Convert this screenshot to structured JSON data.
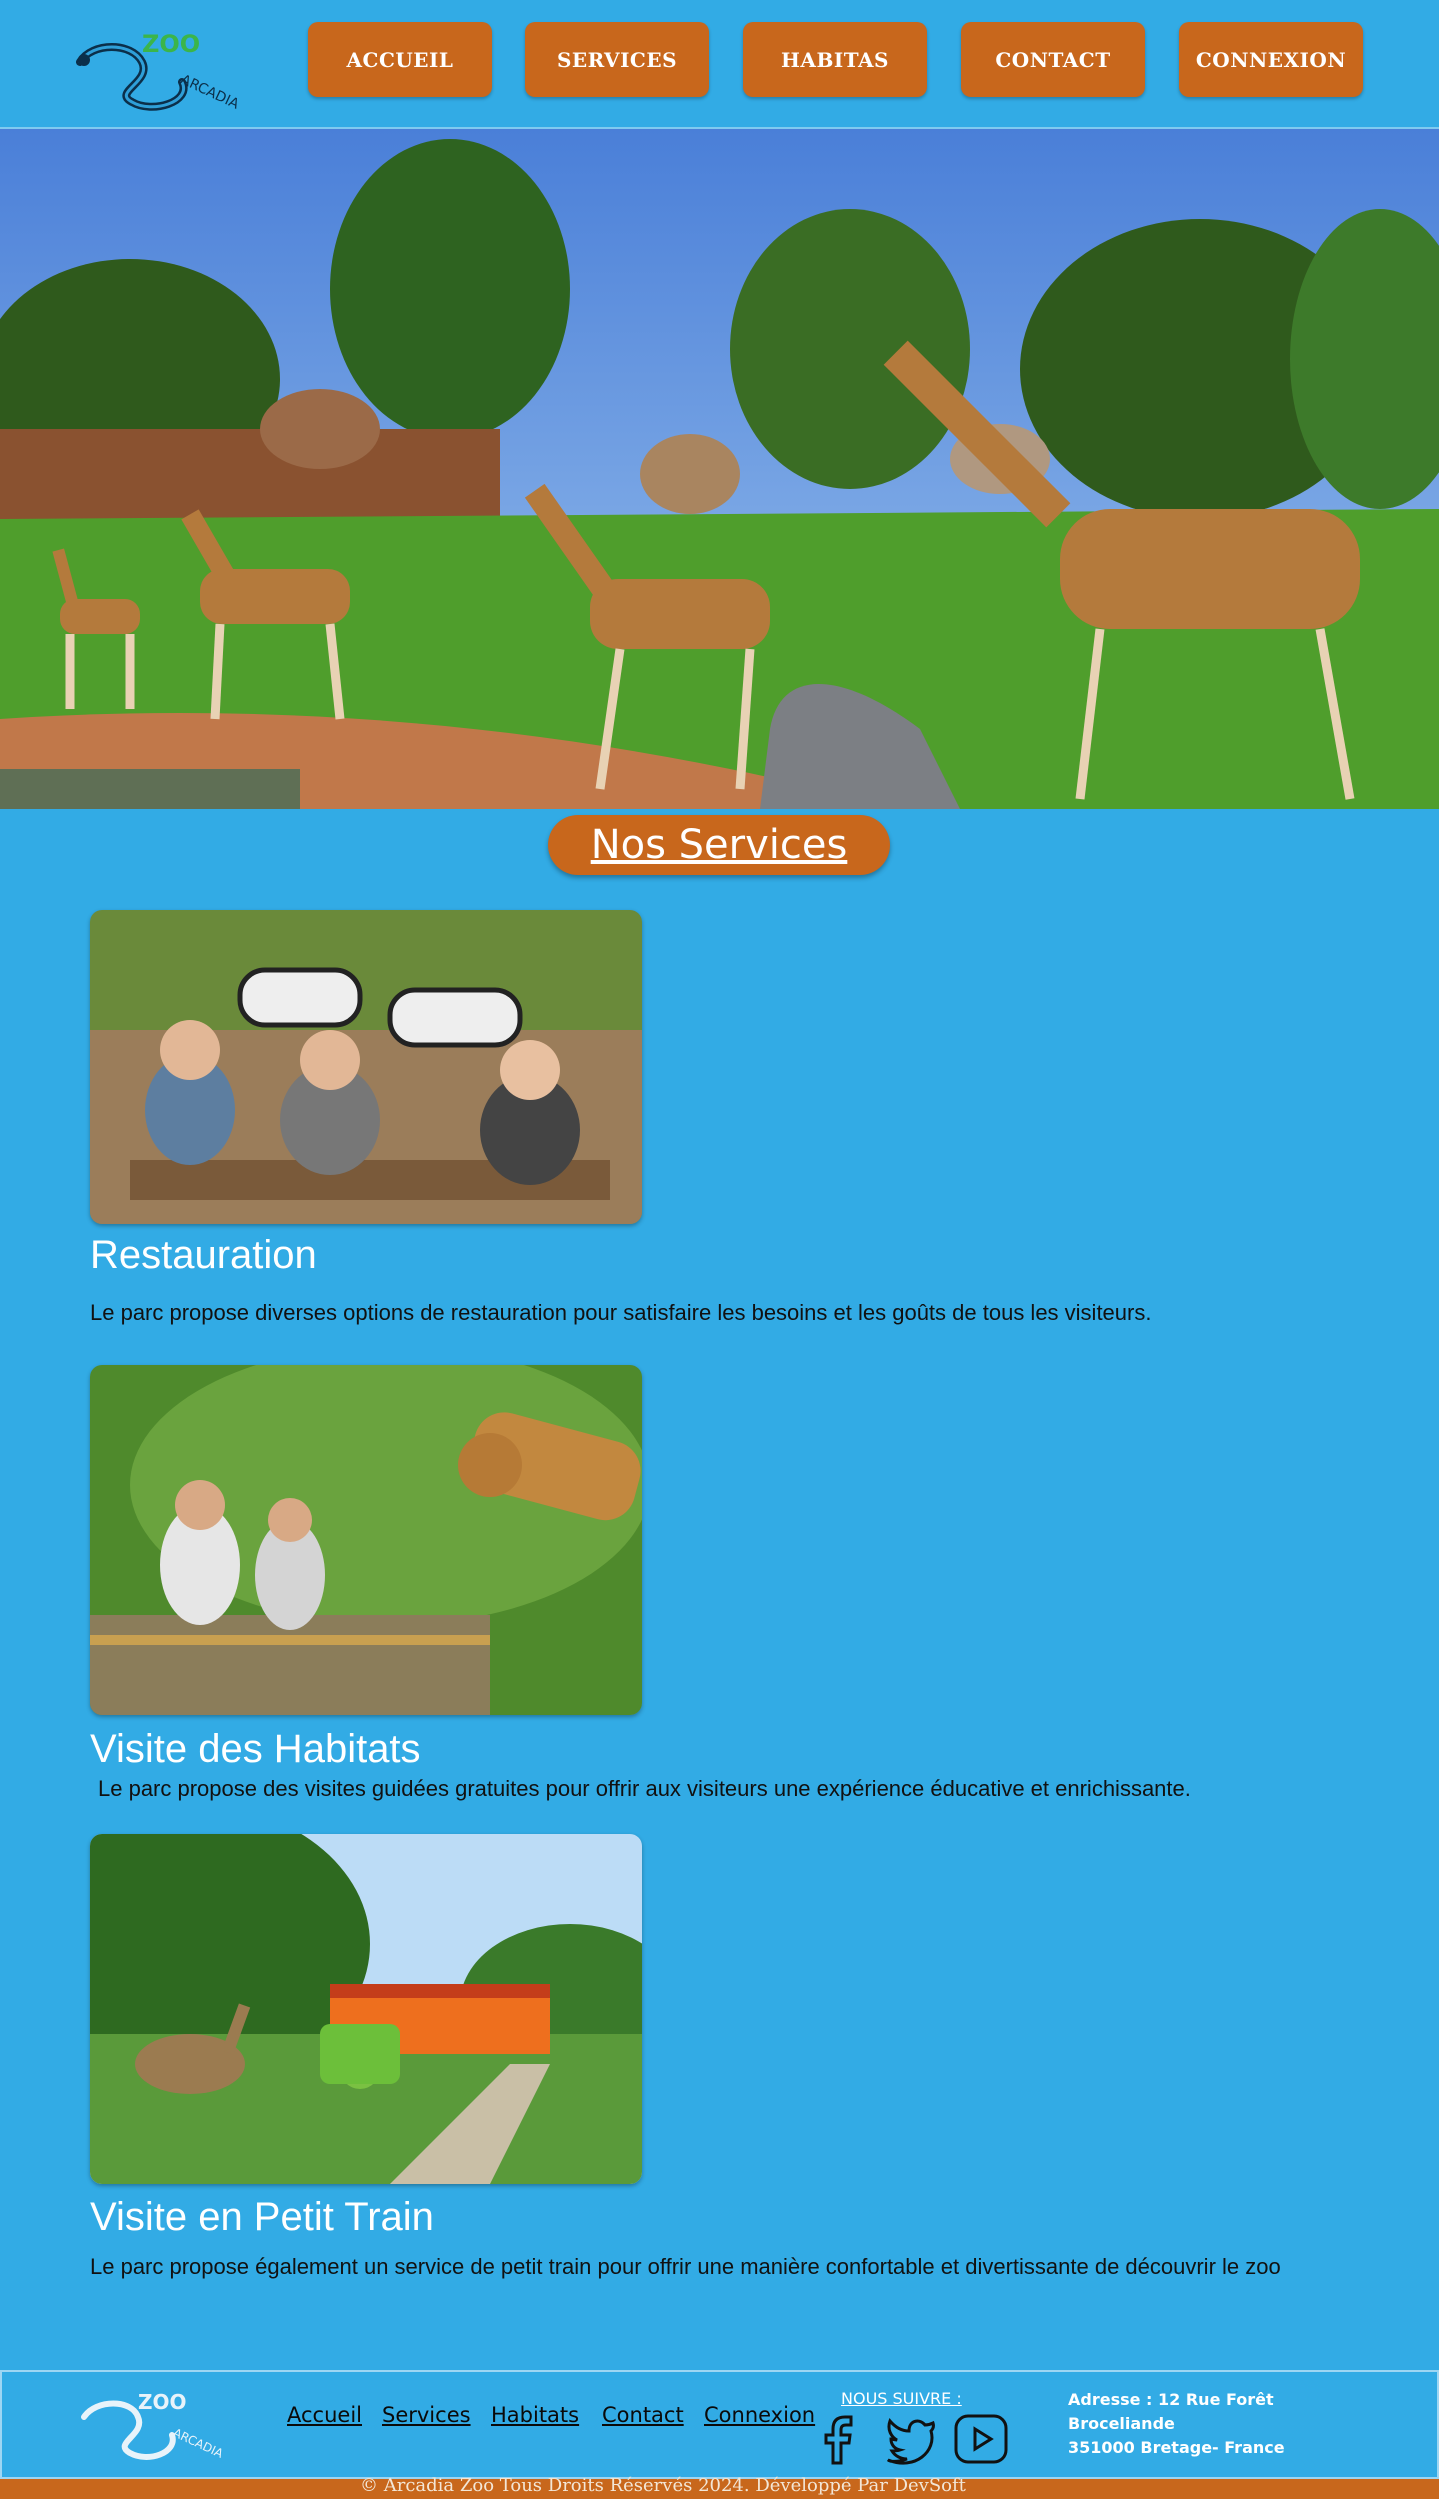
{
  "header": {
    "logo_text": "ZOO ARCADIA",
    "nav": [
      {
        "label": "ACCUEIL"
      },
      {
        "label": "SERVICES"
      },
      {
        "label": "HABITAS"
      },
      {
        "label": "CONTACT"
      },
      {
        "label": "CONNEXION"
      }
    ]
  },
  "hero": {
    "alt": "Girafes dans le parc"
  },
  "services": {
    "title": "Nos Services",
    "items": [
      {
        "title": "Restauration",
        "description": "Le parc propose diverses options de restauration pour satisfaire les besoins et les goûts de tous les visiteurs."
      },
      {
        "title": "Visite des Habitats",
        "description": "Le parc propose des visites guidées gratuites pour offrir aux visiteurs une expérience éducative et enrichissante."
      },
      {
        "title": "Visite en Petit Train",
        "description": "Le parc propose également un service de petit train pour offrir une manière confortable et divertissante de découvrir le zoo"
      }
    ]
  },
  "footer": {
    "links": [
      {
        "label": "Accueil"
      },
      {
        "label": "Services"
      },
      {
        "label": "Habitats"
      },
      {
        "label": "Contact"
      },
      {
        "label": "Connexion"
      }
    ],
    "follow_label": "NOUS SUIVRE :",
    "social": [
      "facebook-icon",
      "twitter-icon",
      "youtube-icon"
    ],
    "address_line1": "Adresse :  12 Rue Forêt",
    "address_line2": "Broceliande",
    "address_line3": "351000 Bretage- France",
    "copyright": "© Arcadia Zoo Tous Droits Réservés  2024. Développé Par DevSoft"
  },
  "colors": {
    "background": "#32abe5",
    "accent": "#c8671c",
    "text_dark": "#111111"
  }
}
